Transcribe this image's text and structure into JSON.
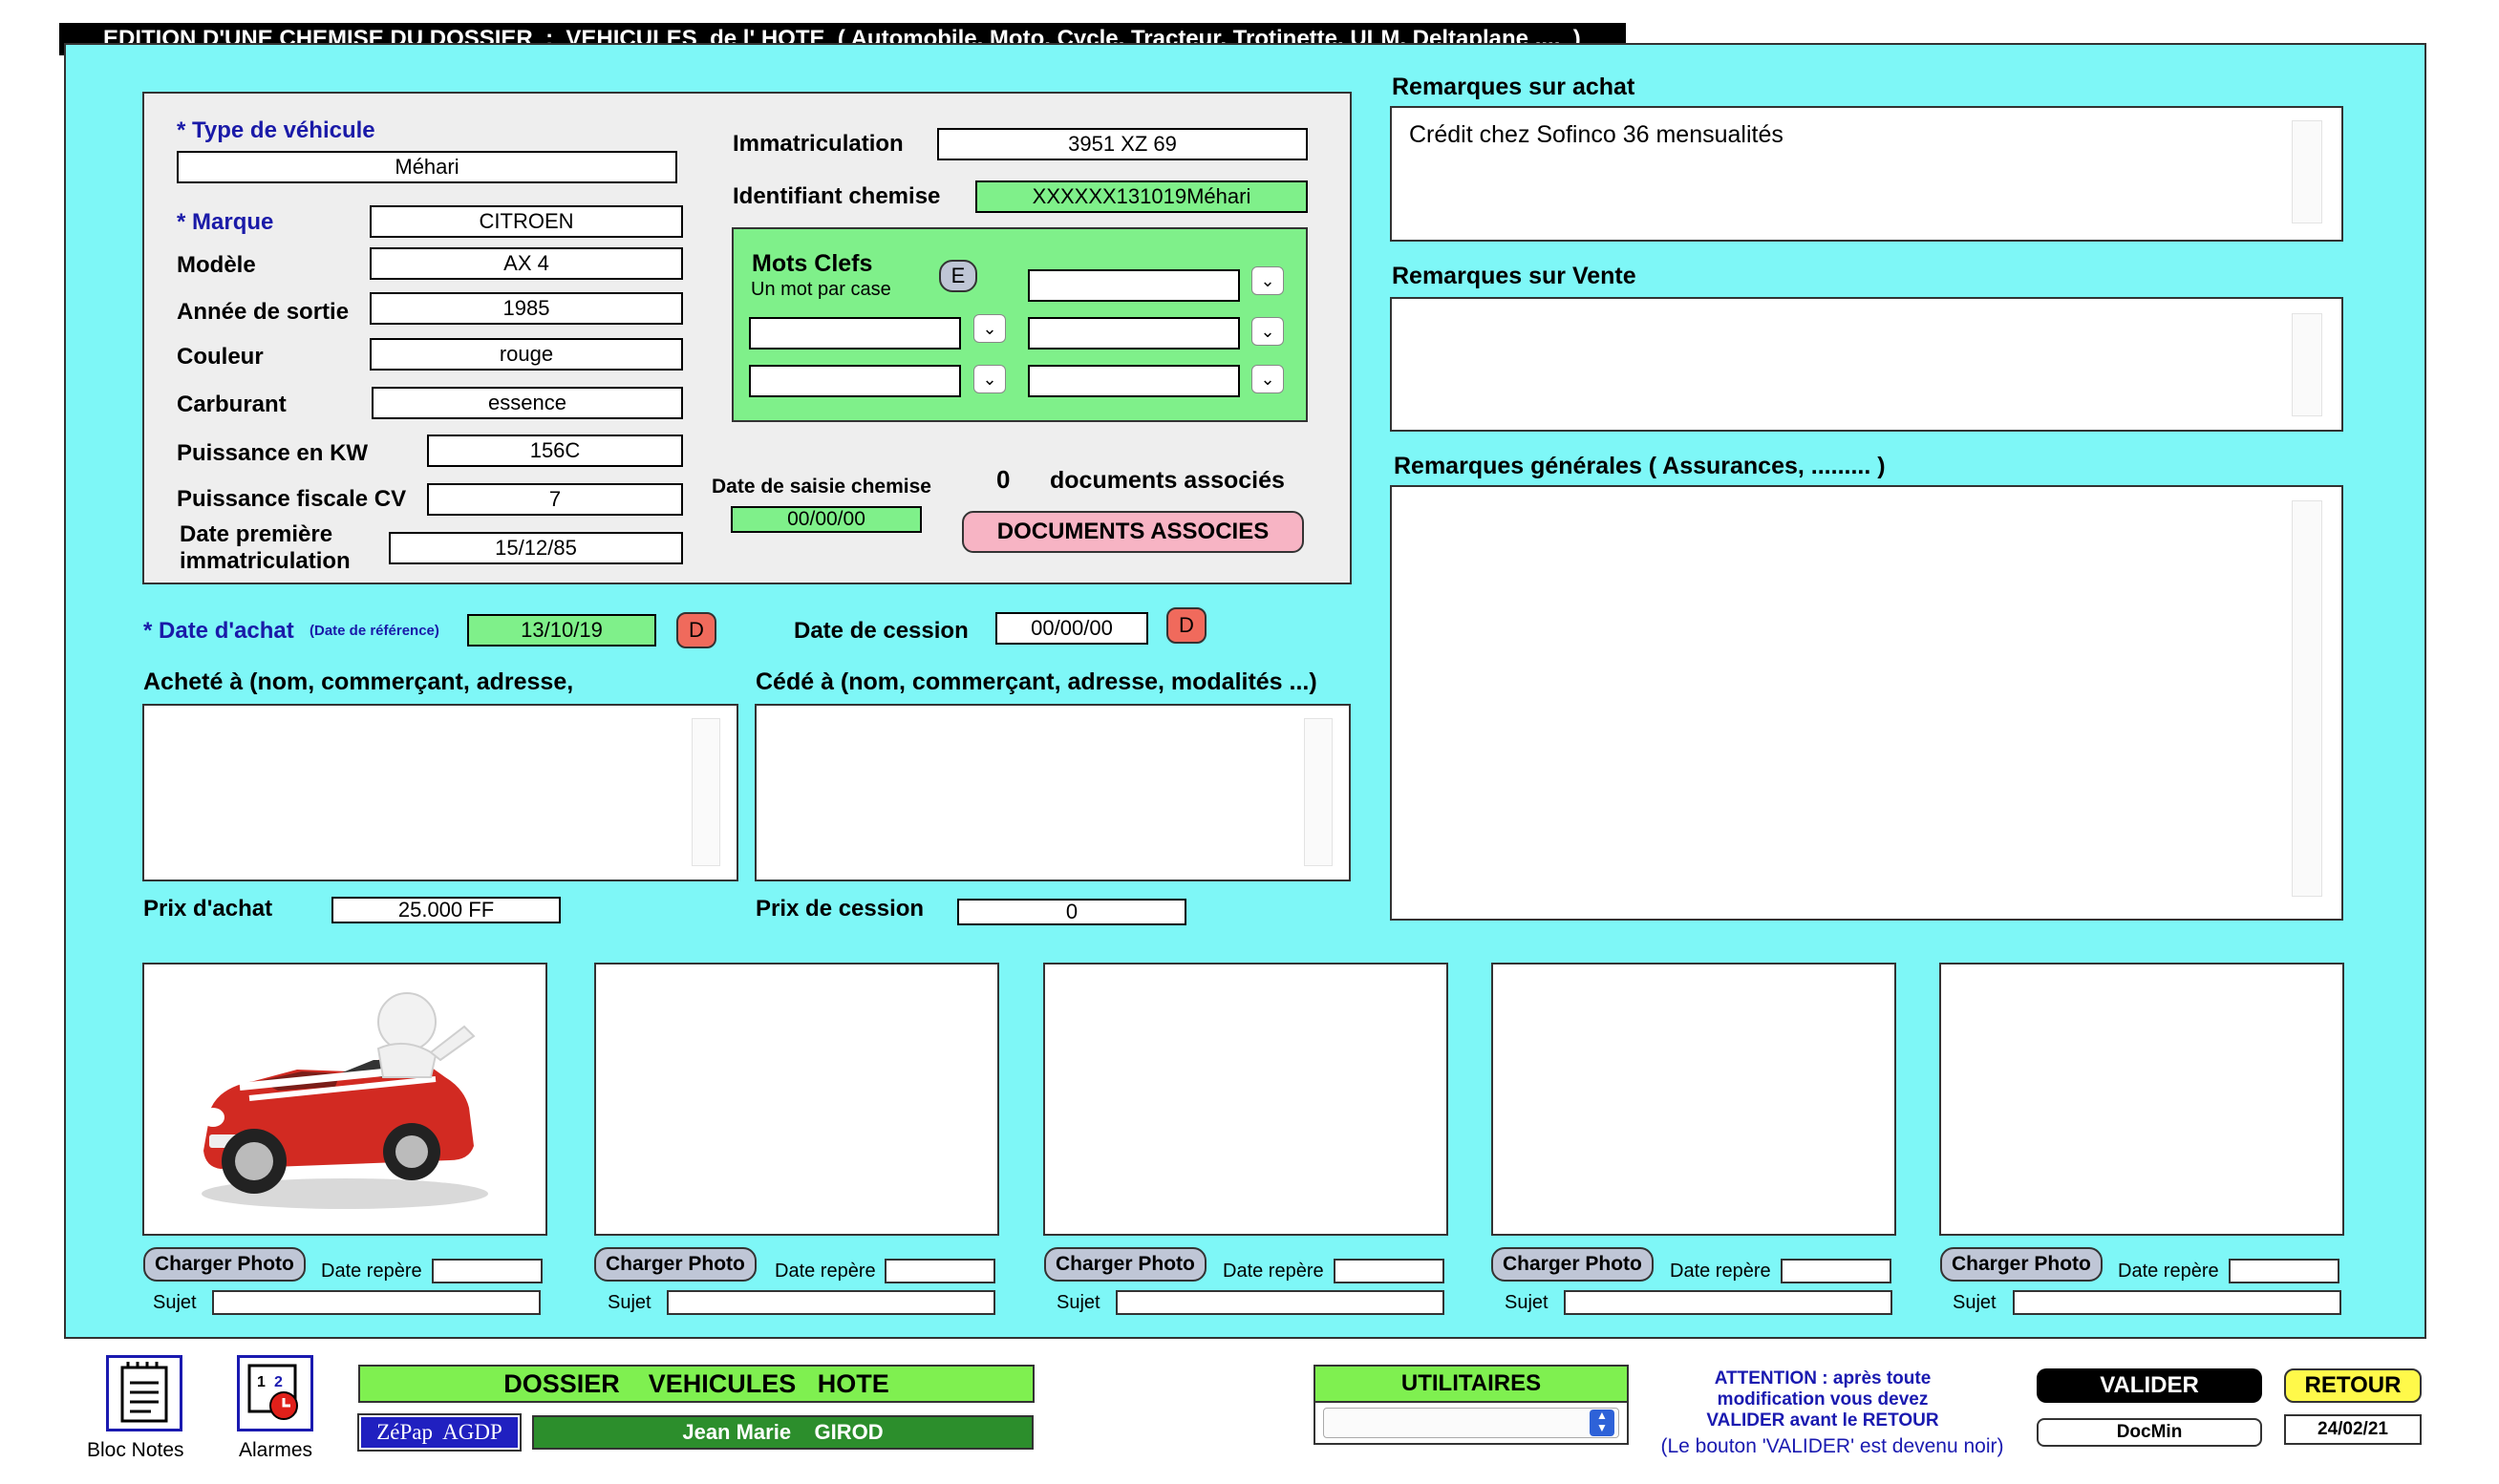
{
  "title": "EDITION D'UNE CHEMISE DU DOSSIER  :  VEHICULES  de l' HOTE  ( Automobile, Moto, Cycle, Tracteur, Trotinette, ULM, Deltaplane ....  )",
  "colors": {
    "background": "#7ef7f7",
    "panel": "#eeeeee",
    "green_field": "#7ff08a",
    "d_button": "#f06a5c"
  },
  "vehicle": {
    "type_label": "* Type de véhicule",
    "type_value": "Méhari",
    "marque_label": "* Marque",
    "marque_value": "CITROEN",
    "modele_label": "Modèle",
    "modele_value": "AX 4",
    "annee_label": "Année de sortie",
    "annee_value": "1985",
    "couleur_label": "Couleur",
    "couleur_value": "rouge",
    "carburant_label": "Carburant",
    "carburant_value": "essence",
    "puissance_kw_label": "Puissance  en KW",
    "puissance_kw_value": "156C",
    "puissance_cv_label": "Puissance fiscale CV",
    "puissance_cv_value": "7",
    "date_immat_label_1": "Date première",
    "date_immat_label_2": "immatriculation",
    "date_immat_value": "15/12/85",
    "immatriculation_label": "Immatriculation",
    "immatriculation_value": "3951 XZ 69",
    "identifiant_label": "Identifiant chemise",
    "identifiant_value": "XXXXXX131019Méhari"
  },
  "keywords": {
    "title": "Mots Clefs",
    "subtitle": "Un mot par case",
    "e_button": "E",
    "chevron": "⌄",
    "values": [
      "",
      "",
      "",
      "",
      ""
    ]
  },
  "saisie": {
    "label": "Date de saisie chemise",
    "value": "00/00/00"
  },
  "documents": {
    "count": "0",
    "label": "documents associés",
    "button": "DOCUMENTS ASSOCIES"
  },
  "achat": {
    "date_label": "* Date d'achat",
    "date_ref": "(Date de référence)",
    "date_value": "13/10/19",
    "d_button": "D",
    "achete_label": "Acheté à  (nom, commerçant, adresse,",
    "achete_value": "",
    "prix_label": "Prix d'achat",
    "prix_value": "25.000 FF"
  },
  "cession": {
    "date_label": "Date de cession",
    "date_value": "00/00/00",
    "d_button": "D",
    "cede_label": "Cédé à  (nom, commerçant, adresse, modalités ...)",
    "cede_value": "",
    "prix_label": "Prix de cession",
    "prix_value": "0"
  },
  "remarks": {
    "achat_label": "Remarques sur achat",
    "achat_value": "Crédit chez Sofinco  36 mensualités",
    "vente_label": "Remarques sur Vente",
    "vente_value": "",
    "generales_label": "Remarques générales  (  Assurances, ......... )",
    "generales_value": ""
  },
  "photos": {
    "button": "Charger Photo",
    "date_label": "Date repère",
    "sujet_label": "Sujet",
    "items": [
      {
        "has_image": true,
        "image_name": "red-convertible-car-photo"
      },
      {
        "has_image": false
      },
      {
        "has_image": false
      },
      {
        "has_image": false
      },
      {
        "has_image": false
      }
    ]
  },
  "footer": {
    "bloc_notes": "Bloc Notes",
    "alarmes": "Alarmes",
    "dossier": "DOSSIER    VEHICULES   HOTE",
    "zepap": "ZéPap  AGDP",
    "user": "Jean Marie    GIROD",
    "utilitaires": "UTILITAIRES",
    "utilitaires_value": "",
    "attention": [
      "ATTENTION :  après toute",
      "modification vous devez",
      "VALIDER avant le RETOUR",
      "(Le bouton 'VALIDER' est devenu noir)"
    ],
    "valider": "VALIDER",
    "retour": "RETOUR",
    "docmin": "DocMin",
    "date": "24/02/21"
  }
}
